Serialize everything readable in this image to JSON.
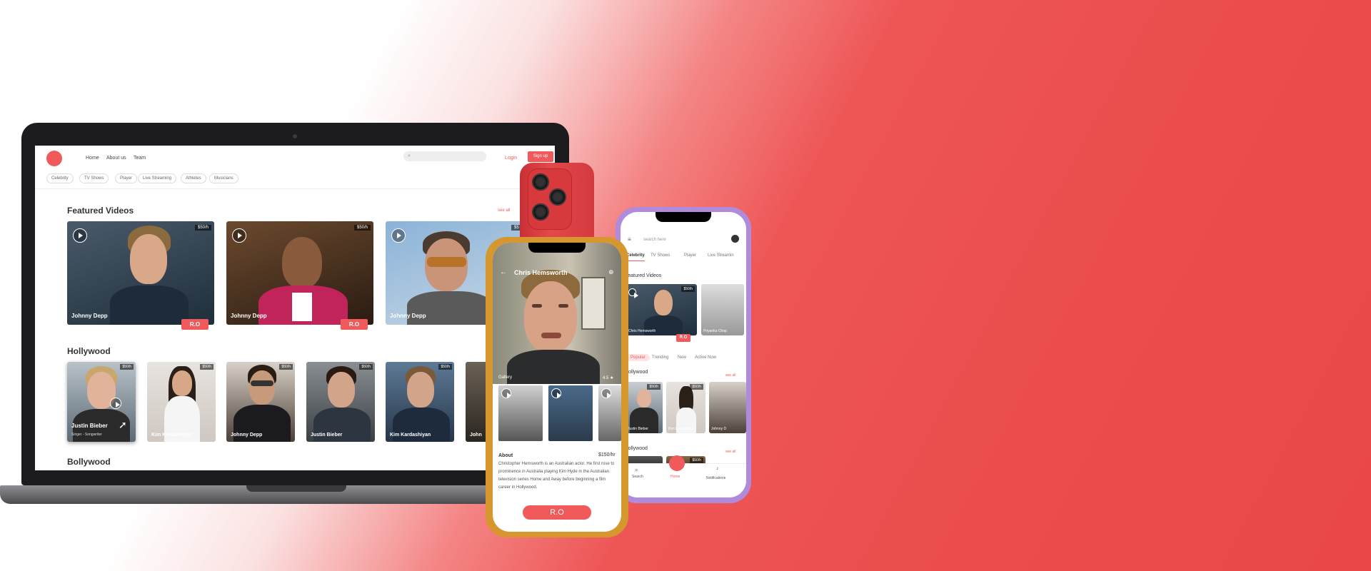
{
  "site": {
    "nav": [
      "Home",
      "About us",
      "Team"
    ],
    "login": "Login",
    "signup": "Sign up",
    "categories": [
      "Celebrity",
      "TV Shows",
      "Player",
      "Live Streaming",
      "Athletes",
      "Musicians"
    ],
    "featured_title": "Featured Videos",
    "see_all": "see all",
    "featured": [
      {
        "name": "Johnny Depp",
        "price": "$50/h",
        "action": "R.O"
      },
      {
        "name": "Johnny Depp",
        "price": "$50/h",
        "action": "R.O"
      },
      {
        "name": "Johnny Depp",
        "price": "$5"
      }
    ],
    "hollywood_title": "Hollywood",
    "hollywood": [
      {
        "name": "Justin Bieber",
        "sub": "Singer - Songwriter",
        "price": "$50/h"
      },
      {
        "name": "Kim Kardashiyan",
        "price": "$50/h"
      },
      {
        "name": "Johnny Depp",
        "price": "$50/h"
      },
      {
        "name": "Justin Bieber",
        "price": "$50/h"
      },
      {
        "name": "Kim Kardashiyan",
        "price": "$50/h"
      },
      {
        "name": "John",
        "price": ""
      }
    ],
    "bollywood_title": "Bollywood"
  },
  "detail_phone": {
    "title": "Chris Hemsworth",
    "gallery_label": "Gallery",
    "rating": "4.5 ★",
    "about_label": "About",
    "price": "$150/hr",
    "about_text": "Christopher Hemsworth is an Australian actor. He first rose to prominence in Australia playing Kim Hyde in the Australian television series Home and Away before beginning a film career in Hollywood.",
    "action": "R.O"
  },
  "app_phone": {
    "search_placeholder": "search here",
    "tabs": [
      "Celebrity",
      "TV Shows",
      "Player",
      "Live Streamin"
    ],
    "featured_title": "Featured Videos",
    "featured": [
      {
        "name": "Chris Hemsworth",
        "price": "$50/h",
        "action": "R.O"
      },
      {
        "name": "Priyanka Chop"
      }
    ],
    "filters": [
      "Popular",
      "Trending",
      "New",
      "Active Now"
    ],
    "hollywood_title": "Hollywood",
    "see_all": "see all",
    "hollywood": [
      {
        "name": "Justin Bieber",
        "price": "$50/h"
      },
      {
        "name": "Kim Kardashiyan",
        "price": "$50/h"
      },
      {
        "name": "Johnny D"
      }
    ],
    "bollywood_title": "Bollywood",
    "bollywood_price": "$50/h",
    "bottom_nav": [
      "Search",
      "Home",
      "Notifications"
    ]
  },
  "colors": {
    "accent": "#f05a5a",
    "background": "#ec4c4c",
    "gold_frame": "#d7972f",
    "purple_frame": "#b08bdc"
  }
}
